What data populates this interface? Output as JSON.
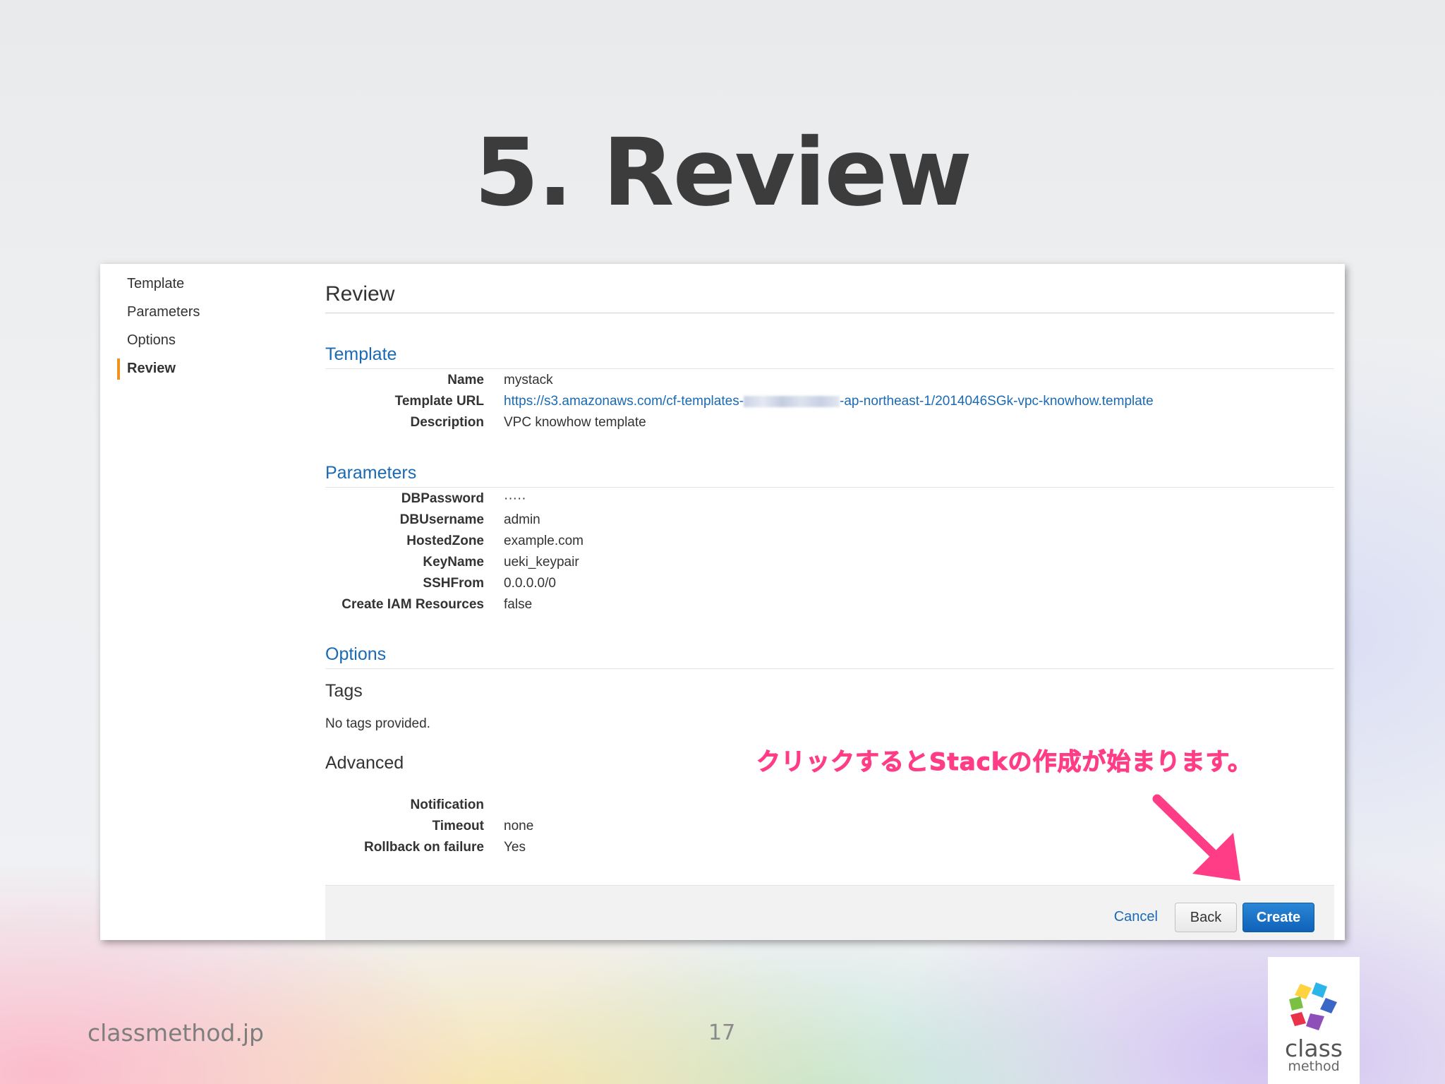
{
  "slide": {
    "title": "5. Review",
    "site": "classmethod.jp",
    "page_number": "17",
    "callout": "クリックするとStackの作成が始まります。",
    "logo": {
      "word1": "class",
      "word2": "method",
      "colors": [
        "#ffd23f",
        "#7ac143",
        "#2bb5e8",
        "#e8334a",
        "#8e4fb8",
        "#3a66c6"
      ]
    }
  },
  "sidebar": {
    "items": [
      {
        "label": "Template",
        "active": false
      },
      {
        "label": "Parameters",
        "active": false
      },
      {
        "label": "Options",
        "active": false
      },
      {
        "label": "Review",
        "active": true
      }
    ]
  },
  "review": {
    "heading": "Review",
    "template": {
      "title": "Template",
      "rows": [
        {
          "key": "Name",
          "value": "mystack"
        },
        {
          "key": "Template URL",
          "value_prefix": "https://s3.amazonaws.com/cf-templates-",
          "value_suffix": "-ap-northeast-1/2014046SGk-vpc-knowhow.template"
        },
        {
          "key": "Description",
          "value": "VPC knowhow template"
        }
      ]
    },
    "parameters": {
      "title": "Parameters",
      "rows": [
        {
          "key": "DBPassword",
          "value": "·····"
        },
        {
          "key": "DBUsername",
          "value": "admin"
        },
        {
          "key": "HostedZone",
          "value": "example.com"
        },
        {
          "key": "KeyName",
          "value": "ueki_keypair"
        },
        {
          "key": "SSHFrom",
          "value": "0.0.0.0/0"
        },
        {
          "key": "Create IAM Resources",
          "value": "false"
        }
      ]
    },
    "options": {
      "title": "Options",
      "tags_heading": "Tags",
      "tags_text": "No tags provided.",
      "advanced_heading": "Advanced",
      "rows": [
        {
          "key": "Notification",
          "value": ""
        },
        {
          "key": "Timeout",
          "value": "none"
        },
        {
          "key": "Rollback on failure",
          "value": "Yes"
        }
      ]
    }
  },
  "footer": {
    "cancel_label": "Cancel",
    "back_label": "Back",
    "create_label": "Create"
  },
  "colors": {
    "accent_blue": "#1a6ab4",
    "primary_button": "#0f62b8",
    "active_marker": "#f0931e",
    "callout_pink": "#ff3d86"
  }
}
